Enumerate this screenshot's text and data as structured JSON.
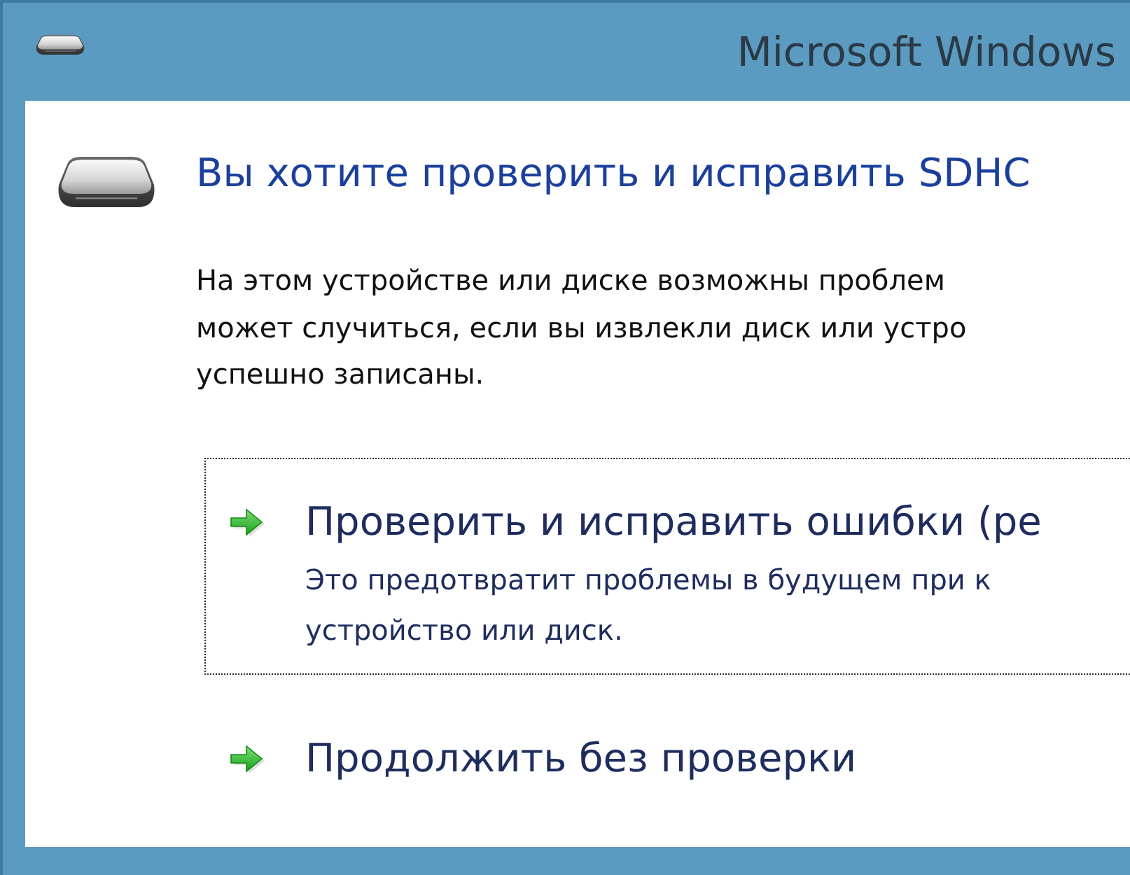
{
  "window": {
    "title": "Microsoft Windows"
  },
  "dialog": {
    "heading": "Вы хотите проверить и исправить SDHC",
    "message_lines": [
      "На этом устройстве или диске возможны проблем",
      "может случиться, если вы извлекли диск или устро",
      "успешно записаны."
    ]
  },
  "options": [
    {
      "title": "Проверить и исправить ошибки (ре",
      "description_lines": [
        "Это предотвратит проблемы в будущем при к",
        "устройство или диск."
      ],
      "focused": true
    },
    {
      "title": "Продолжить без проверки",
      "focused": false
    }
  ]
}
